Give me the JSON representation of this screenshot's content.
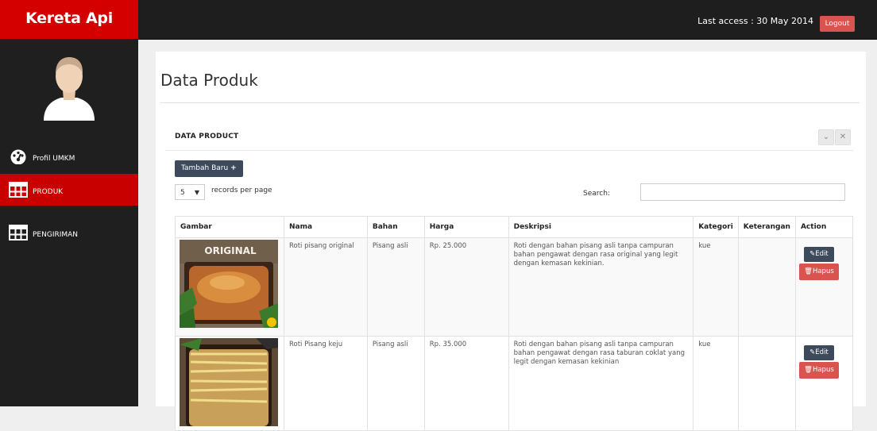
{
  "header": {
    "brand": "Kereta Api",
    "last_access": "Last access : 30 May 2014",
    "logout_label": "Logout"
  },
  "sidebar": {
    "items": [
      {
        "label": "Profil UMKM",
        "icon": "dashboard-icon"
      },
      {
        "label": "PRODUK",
        "icon": "table-icon",
        "active": true
      },
      {
        "label": "PENGIRIMAN",
        "icon": "table-icon"
      }
    ]
  },
  "page": {
    "title": "Data Produk"
  },
  "panel": {
    "title": "DATA PRODUCT",
    "add_label": "Tambah Baru",
    "per_page_value": "5",
    "per_page_label": "records per page",
    "search_label": "Search:",
    "search_value": ""
  },
  "table": {
    "columns": [
      "Gambar",
      "Nama",
      "Bahan",
      "Harga",
      "Deskripsi",
      "Kategori",
      "Keterangan",
      "Action"
    ],
    "rows": [
      {
        "image_text": "ORIGINAL",
        "nama": "Roti pisang original",
        "bahan": "Pisang asli",
        "harga": "Rp. 25.000",
        "deskripsi": "Roti dengan bahan pisang asli tanpa campuran bahan pengawat dengan rasa original yang legit dengan kemasan kekinian.",
        "kategori": "kue",
        "keterangan": "",
        "edit_label": "Edit",
        "delete_label": "Hapus"
      },
      {
        "nama": "Roti Pisang keju",
        "bahan": "Pisang asli",
        "harga": "Rp. 35.000",
        "deskripsi": "Roti dengan bahan pisang asli tanpa campuran bahan pengawat dengan rasa taburan coklat yang legit dengan kemasan kekinian",
        "kategori": "kue",
        "keterangan": "",
        "edit_label": "Edit",
        "delete_label": "Hapus"
      }
    ]
  },
  "colors": {
    "brand_red": "#d40000",
    "active_red": "#c80000",
    "dark": "#1e1e1e",
    "button_dark": "#3d4a5c",
    "danger": "#d9534f"
  }
}
